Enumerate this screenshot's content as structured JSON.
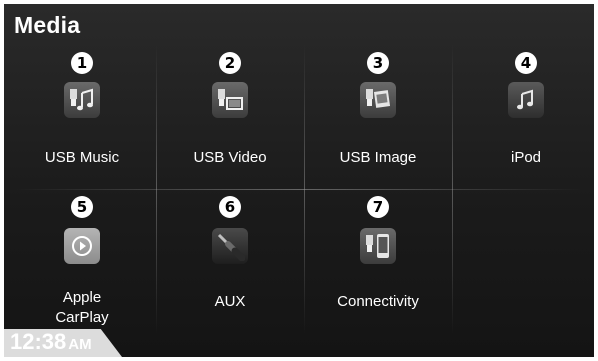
{
  "header": {
    "title": "Media"
  },
  "tiles": [
    {
      "number": "1",
      "label": "USB Music",
      "icon": "usb-music-icon"
    },
    {
      "number": "2",
      "label": "USB Video",
      "icon": "usb-video-icon"
    },
    {
      "number": "3",
      "label": "USB Image",
      "icon": "usb-image-icon"
    },
    {
      "number": "4",
      "label": "iPod",
      "icon": "ipod-icon"
    },
    {
      "number": "5",
      "label_line1": "Apple",
      "label_line2": "CarPlay",
      "icon": "carplay-icon"
    },
    {
      "number": "6",
      "label": "AUX",
      "icon": "aux-cable-icon"
    },
    {
      "number": "7",
      "label": "Connectivity",
      "icon": "usb-phone-connectivity-icon"
    }
  ],
  "status": {
    "time": "12:38",
    "ampm": "AM"
  },
  "colors": {
    "background": "#1b1b1b",
    "text": "#ffffff",
    "badge": "#ffffff",
    "carplay": "#9a9a9a"
  }
}
